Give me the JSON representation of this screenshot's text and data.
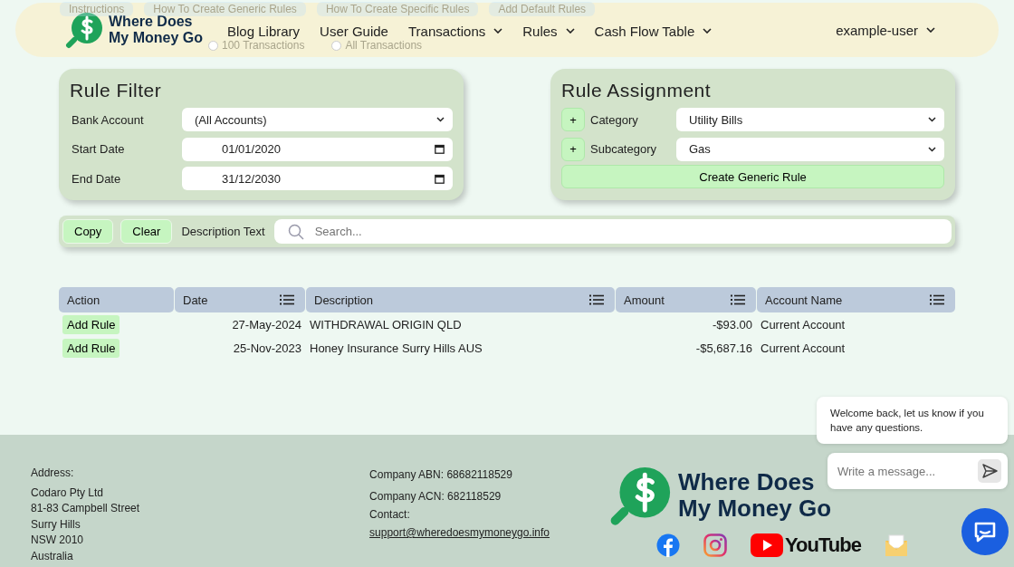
{
  "background_links": {
    "tabs": [
      "Instructions",
      "How To Create Generic Rules",
      "How To Create Specific Rules",
      "Add Default Rules"
    ],
    "transaction_limits": [
      {
        "label": "100 Transactions",
        "selected": false
      },
      {
        "label": "All Transactions",
        "selected": false
      }
    ]
  },
  "navbar": {
    "brand": [
      "Where Does",
      "My Money Go"
    ],
    "items": [
      {
        "label": "Blog Library",
        "dropdown": false
      },
      {
        "label": "User Guide",
        "dropdown": false
      },
      {
        "label": "Transactions",
        "dropdown": true
      },
      {
        "label": "Rules",
        "dropdown": true
      },
      {
        "label": "Cash Flow Table",
        "dropdown": true
      }
    ],
    "user": "example-user"
  },
  "rule_filter": {
    "title": "Rule Filter",
    "fields": [
      {
        "label": "Bank Account",
        "kind": "select",
        "value": "(All Accounts)"
      },
      {
        "label": "Start Date",
        "kind": "date",
        "value": "01/01/2020"
      },
      {
        "label": "End Date",
        "kind": "date",
        "value": "31/12/2030"
      }
    ]
  },
  "rule_assignment": {
    "title": "Rule Assignment",
    "fields": [
      {
        "add": "+",
        "label": "Category",
        "value": "Utility Bills"
      },
      {
        "add": "+",
        "label": "Subcategory",
        "value": "Gas"
      }
    ],
    "button": "Create Generic Rule"
  },
  "search_bar": {
    "buttons": [
      "Copy",
      "Clear"
    ],
    "label": "Description Text",
    "placeholder": "Search..."
  },
  "table": {
    "columns": [
      {
        "label": "Action",
        "menu": false
      },
      {
        "label": "Date",
        "menu": true
      },
      {
        "label": "Description",
        "menu": true
      },
      {
        "label": "Amount",
        "menu": true
      },
      {
        "label": "Account Name",
        "menu": true
      }
    ],
    "rows": [
      {
        "action": "Add Rule",
        "date": "27-May-2024",
        "description": "WITHDRAWAL ORIGIN QLD",
        "amount": "-$93.00",
        "account": "Current Account"
      },
      {
        "action": "Add Rule",
        "date": "25-Nov-2023",
        "description": "Honey Insurance Surry Hills AUS",
        "amount": "-$5,687.16",
        "account": "Current Account"
      }
    ]
  },
  "footer": {
    "address_label": "Address:",
    "address": [
      "Codaro Pty Ltd",
      "81-83 Campbell Street",
      "Surry Hills",
      "NSW 2010",
      "Australia"
    ],
    "company": [
      "Company ABN: 68682118529",
      "Company ACN: 682118529",
      "Contact:"
    ],
    "email": "support@wheredoesmymoneygo.info",
    "brand": [
      "Where Does",
      "My Money Go"
    ],
    "youtube": "YouTube"
  },
  "chat": {
    "message": "Welcome back, let us know if you have any questions.",
    "placeholder": "Write a message..."
  }
}
